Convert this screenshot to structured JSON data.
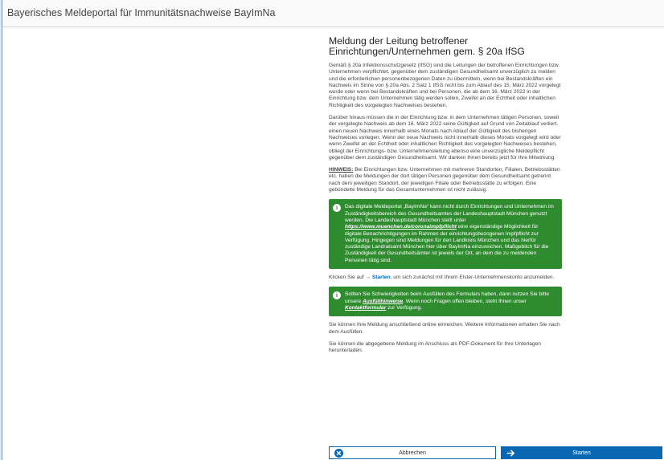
{
  "window": {
    "title": "Bayerisches Meldeportal für Immunitätsnachweise BayImNa"
  },
  "main": {
    "heading": "Meldung der Leitung betroffener Einrichtungen/Unternehmen gem. § 20a IfSG",
    "paragraph1": "Gemäß § 20a Infektionsschutzgesetz (IfSG) sind die Leitungen der betroffenen Einrichtungen bzw. Unternehmen verpflichtet, gegenüber dem zuständigen Gesundheitsamt unverzüglich zu melden und die erforderlichen personenbezogenen Daten zu übermitteln, wenn bei Bestandskräften ein Nachweis im Sinne von § 20a Abs. 2 Satz 1 IfSG nicht bis zum Ablauf des 15. März 2022 vorgelegt wurde oder wenn bei Bestandskräften und bei Personen, die ab dem 16. März 2022 in der Einrichtung bzw. dem Unternehmen tätig werden sollen, Zweifel an der Echtheit oder inhaltlichen Richtigkeit des vorgelegten Nachweises bestehen.",
    "paragraph2": "Darüber hinaus müssen die in der Einrichtung bzw. in dem Unternehmen tätigen Personen, soweit der vorgelegte Nachweis ab dem 16. März 2022 seine Gültigkeit auf Grund von Zeitablauf verliert, einen neuen Nachweis innerhalb eines Monats nach Ablauf der Gültigkeit des bisherigen Nachweises vorlegen. Wenn der neue Nachweis nicht innerhalb dieses Monats vorgelegt wird oder wenn Zweifel an der Echtheit oder inhaltlichen Richtigkeit des vorgelegten Nachweises bestehen, obliegt der Einrichtungs- bzw. Unternehmensleitung ebenso eine unverzügliche Meldepflicht gegenüber dem zuständigen Gesundheitsamt. Wir danken Ihnen bereits jetzt für Ihre Mitwirkung.",
    "hint_label": "HINWEIS:",
    "hint_text": " Bei Einrichtungen bzw. Unternehmen mit mehreren Standorten, Filialen, Betriebsstätten etc. haben die Meldungen der dort tätigen Personen gegenüber dem Gesundheitsamt getrennt nach dem jeweiligen Standort, der jeweiligen Filiale oder Betriebsstätte zu erfolgen. Eine gebündelte Meldung für das Gesamtunternehmen ist nicht zulässig.",
    "notice1": {
      "text_a": "Das digitale Meldeportal „BayImNa“ kann nicht durch Einrichtungen und Unternehmen im Zuständigkeitsbereich des Gesundheitsamtes der Landeshauptstadt München genutzt werden. Die Landeshauptstadt München stellt unter ",
      "link": "https://www.muenchen.de/coronaimpfpflicht",
      "text_b": " eine eigenständige Möglichkeit für digitale Benachrichtigungen im Rahmen der einrichtungsbezogenen Impfpflicht zur Verfügung. Hingegen sind Meldungen für den Landkreis München und das hierfür zuständige Landratsamt München hier über BayImNa einzureichen. Maßgeblich für die Zuständigkeit der Gesundheitsämter ist jeweils der Ort, an dem die zu meldenden Personen tätig sind."
    },
    "start_text_a": "Klicken Sie auf ",
    "start_text_link": "→ Starten",
    "start_text_b": ", um sich zunächst mit Ihrem Elster-Unternehmenskonto anzumelden.",
    "notice2": {
      "text_a": "Sollten Sie Schwierigkeiten beim Ausfüllen des Formulars haben, dann nutzen Sie bitte unsere ",
      "link1": "Ausfüllhinweise",
      "text_b": ". Wenn noch Fragen offen bleiben, steht Ihnen unser ",
      "link2": "Kontaktformular",
      "text_c": " zur Verfügung."
    },
    "paragraph3": "Sie können Ihre Meldung anschließend online einreichen. Weitere Informationen erhalten Sie nach dem Ausfüllen.",
    "paragraph4": "Sie können die abgegebene Meldung im Anschluss als PDF-Dokument für Ihre Unterlagen herunterladen."
  },
  "buttons": {
    "cancel_label": "Abbrechen",
    "start_label": "Starten"
  },
  "colors": {
    "accent": "#0a67b2",
    "notice_bg": "#2e8b2e"
  }
}
